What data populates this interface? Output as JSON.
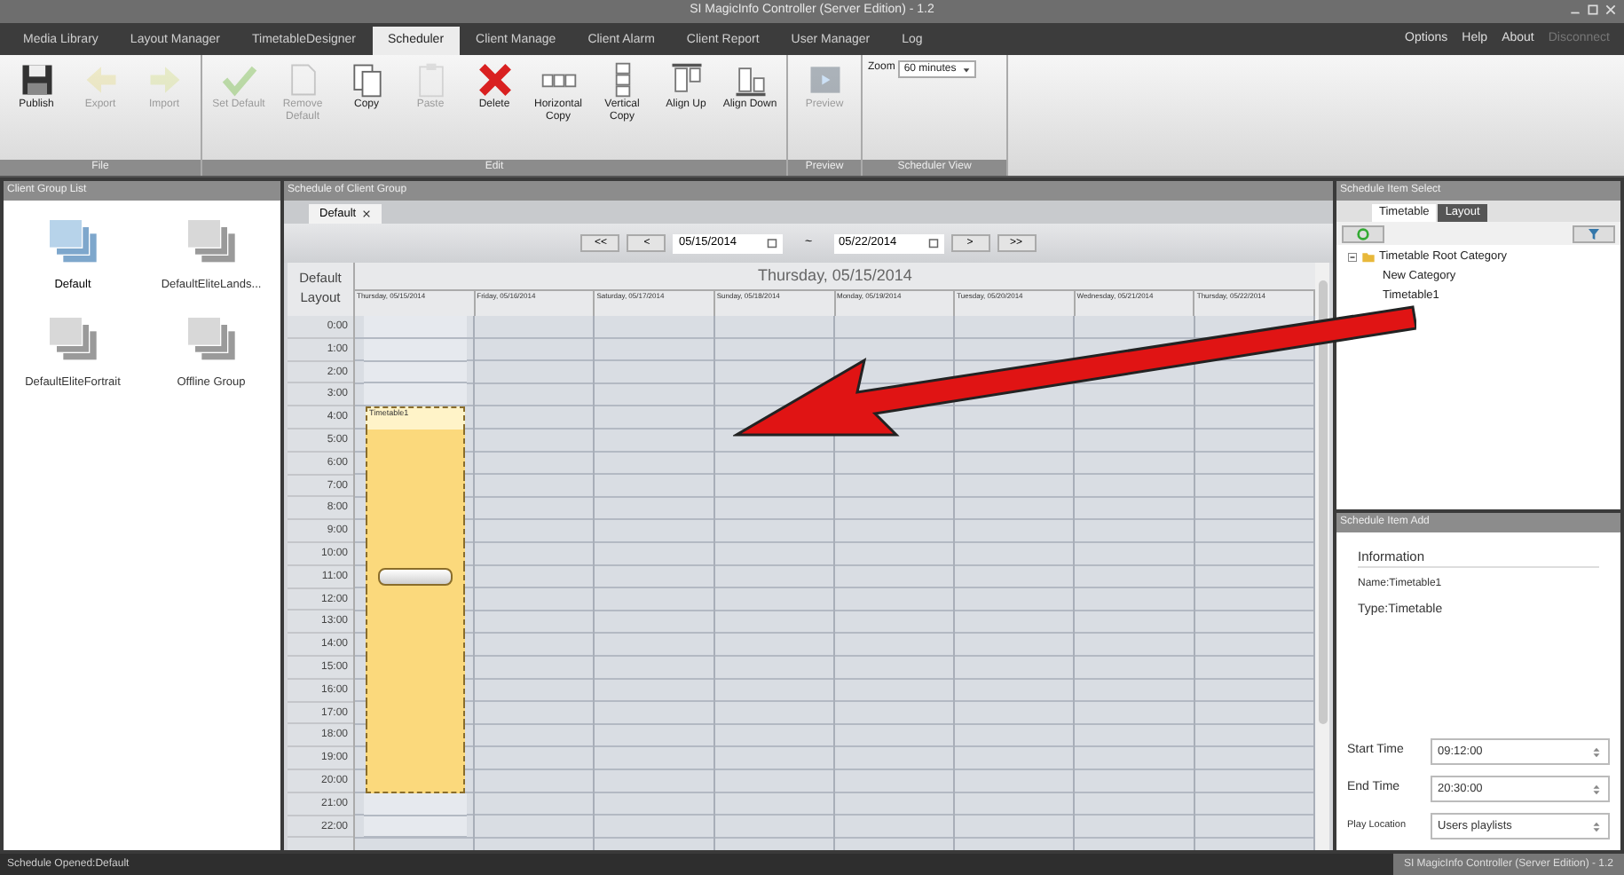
{
  "window": {
    "title": "SI MagicInfo Controller (Server Edition) - 1.2"
  },
  "menu_tabs": [
    {
      "label": "Media Library",
      "selected": false
    },
    {
      "label": "Layout Manager",
      "selected": false
    },
    {
      "label": "TimetableDesigner",
      "selected": false
    },
    {
      "label": "Scheduler",
      "selected": true
    },
    {
      "label": "Client Manage",
      "selected": false
    },
    {
      "label": "Client Alarm",
      "selected": false
    },
    {
      "label": "Client Report",
      "selected": false
    },
    {
      "label": "User Manager",
      "selected": false
    },
    {
      "label": "Log",
      "selected": false
    }
  ],
  "menu_links": [
    {
      "label": "Options",
      "disabled": false
    },
    {
      "label": "Help",
      "disabled": false
    },
    {
      "label": "About",
      "disabled": false
    },
    {
      "label": "Disconnect",
      "disabled": true
    }
  ],
  "ribbon": {
    "groups": [
      {
        "label": "File",
        "buttons": [
          {
            "label": "Publish",
            "kind": "save",
            "disabled": false
          },
          {
            "label": "Export",
            "kind": "export",
            "disabled": true
          },
          {
            "label": "Import",
            "kind": "import",
            "disabled": true
          }
        ]
      },
      {
        "label": "Edit",
        "buttons": [
          {
            "label": "Set Default",
            "kind": "check",
            "disabled": true
          },
          {
            "label": "Remove Default",
            "kind": "doc",
            "disabled": true
          },
          {
            "label": "Copy",
            "kind": "copy",
            "disabled": false
          },
          {
            "label": "Paste",
            "kind": "paste",
            "disabled": true
          },
          {
            "label": "Delete",
            "kind": "delete",
            "disabled": false
          },
          {
            "label": "Horizontal Copy",
            "kind": "hcopy",
            "disabled": false
          },
          {
            "label": "Vertical Copy",
            "kind": "vcopy",
            "disabled": false
          },
          {
            "label": "Align Up",
            "kind": "alignup",
            "disabled": false
          },
          {
            "label": "Align Down",
            "kind": "aligndown",
            "disabled": false
          }
        ]
      },
      {
        "label": "Preview",
        "buttons": [
          {
            "label": "Preview",
            "kind": "preview",
            "disabled": true
          }
        ]
      }
    ],
    "zoom": {
      "label": "Zoom",
      "value": "60 minutes",
      "group_label": "Scheduler View"
    }
  },
  "client_group_list": {
    "title": "Client Group List",
    "items": [
      {
        "label": "Default",
        "selected": true
      },
      {
        "label": "DefaultEliteLands...",
        "selected": false
      },
      {
        "label": "DefaultEliteFortrait",
        "selected": false
      },
      {
        "label": "Offline Group",
        "selected": false
      }
    ]
  },
  "schedule": {
    "title": "Schedule of Client Group",
    "tabs": [
      {
        "label": "Default",
        "selected": true
      }
    ],
    "nav": {
      "first": "<<",
      "prev": "<",
      "from": "05/15/2014",
      "separator": "~",
      "to": "05/22/2014",
      "next": ">",
      "last": ">>"
    },
    "layout_label": "Default Layout",
    "date_title": "Thursday, 05/15/2014",
    "columns": [
      "Thursday, 05/15/2014",
      "Friday, 05/16/2014",
      "Saturday, 05/17/2014",
      "Sunday, 05/18/2014",
      "Monday, 05/19/2014",
      "Tuesday, 05/20/2014",
      "Wednesday, 05/21/2014",
      "Thursday, 05/22/2014"
    ],
    "event": {
      "label": "Timetable1"
    },
    "hours": [
      {
        "label": "0:00",
        "booked": false
      },
      {
        "label": "1:00",
        "booked": false
      },
      {
        "label": "2:00",
        "booked": false
      },
      {
        "label": "3:00",
        "booked": false
      },
      {
        "label": "4:00",
        "booked": true
      },
      {
        "label": "5:00",
        "booked": true
      },
      {
        "label": "6:00",
        "booked": true
      },
      {
        "label": "7:00",
        "booked": true
      },
      {
        "label": "8:00",
        "booked": true
      },
      {
        "label": "9:00",
        "booked": true
      },
      {
        "label": "10:00",
        "booked": true
      },
      {
        "label": "11:00",
        "booked": true
      },
      {
        "label": "12:00",
        "booked": true
      },
      {
        "label": "13:00",
        "booked": true
      },
      {
        "label": "14:00",
        "booked": true
      },
      {
        "label": "15:00",
        "booked": true
      },
      {
        "label": "16:00",
        "booked": true
      },
      {
        "label": "17:00",
        "booked": true
      },
      {
        "label": "18:00",
        "booked": true
      },
      {
        "label": "19:00",
        "booked": true
      },
      {
        "label": "20:00",
        "booked": true
      },
      {
        "label": "21:00",
        "booked": false
      },
      {
        "label": "22:00",
        "booked": false
      }
    ]
  },
  "item_select": {
    "title": "Schedule Item Select",
    "tabs": [
      {
        "label": "Timetable",
        "selected": true
      },
      {
        "label": "Layout",
        "selected": false
      }
    ],
    "tree": [
      {
        "label": "Timetable Root Category",
        "expanded": true,
        "children": [
          {
            "label": "New Category"
          },
          {
            "label": "Timetable1"
          }
        ]
      }
    ]
  },
  "item_add": {
    "title": "Schedule Item Add",
    "section": "Information",
    "name": "Name:Timetable1",
    "type": "Type:Timetable",
    "fields": [
      {
        "label": "Start Time",
        "value": "09:12:00"
      },
      {
        "label": "End Time",
        "value": "20:30:00"
      },
      {
        "label": "Play Location",
        "value": "Users playlists"
      }
    ]
  },
  "status_bar": {
    "left": "Schedule Opened:Default",
    "right": "SI MagicInfo Controller (Server Edition) - 1.2"
  }
}
